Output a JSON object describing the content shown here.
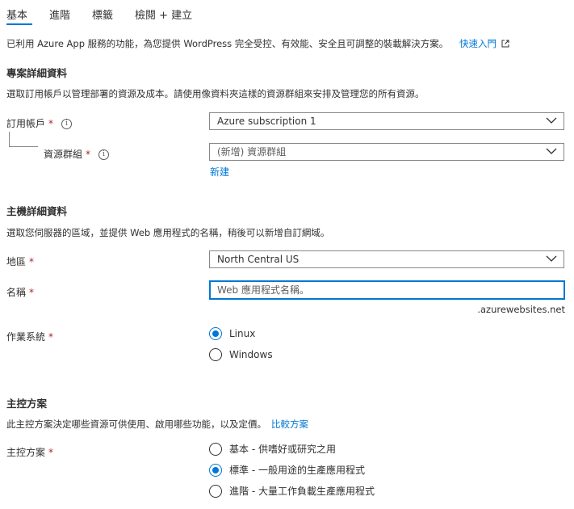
{
  "tabs": [
    {
      "label": "基本",
      "active": true
    },
    {
      "label": "進階",
      "active": false
    },
    {
      "label": "標籤",
      "active": false
    },
    {
      "label": "檢閱 + 建立",
      "active": false
    }
  ],
  "intro": {
    "text": "已利用 Azure App 服務的功能，為您提供 WordPress 完全受控、有效能、安全且可調整的裝載解決方案。",
    "link": "快速入門"
  },
  "project": {
    "title": "專案詳細資料",
    "desc": "選取訂用帳戶以管理部署的資源及成本。請使用像資料夾這樣的資源群組來安排及管理您的所有資源。",
    "subscription_label": "訂用帳戶",
    "subscription_value": "Azure subscription 1",
    "rg_label": "資源群組",
    "rg_value": "(新增) 資源群組",
    "rg_new_link": "新建"
  },
  "host": {
    "title": "主機詳細資料",
    "desc": "選取您伺服器的區域，並提供 Web 應用程式的名稱，稍後可以新增自訂網域。",
    "region_label": "地區",
    "region_value": "North Central US",
    "name_label": "名稱",
    "name_placeholder": "Web 應用程式名稱。",
    "name_suffix": ".azurewebsites.net",
    "os_label": "作業系統",
    "os_options": [
      {
        "label": "Linux",
        "selected": true
      },
      {
        "label": "Windows",
        "selected": false
      }
    ]
  },
  "plan": {
    "title": "主控方案",
    "desc": "此主控方案決定哪些資源可供使用、啟用哪些功能，以及定價。",
    "compare_link": "比較方案",
    "plan_label": "主控方案",
    "options": [
      {
        "label": "基本 - 供嗜好或研究之用",
        "selected": false
      },
      {
        "label": "標準 - 一般用途的生產應用程式",
        "selected": true
      },
      {
        "label": "進階 - 大量工作負載生產應用程式",
        "selected": false
      }
    ]
  },
  "required_mark": "*",
  "info_glyph": "i",
  "colors": {
    "accent": "#0078d4",
    "required": "#a4262c",
    "text": "#323130",
    "border": "#8a8886"
  }
}
